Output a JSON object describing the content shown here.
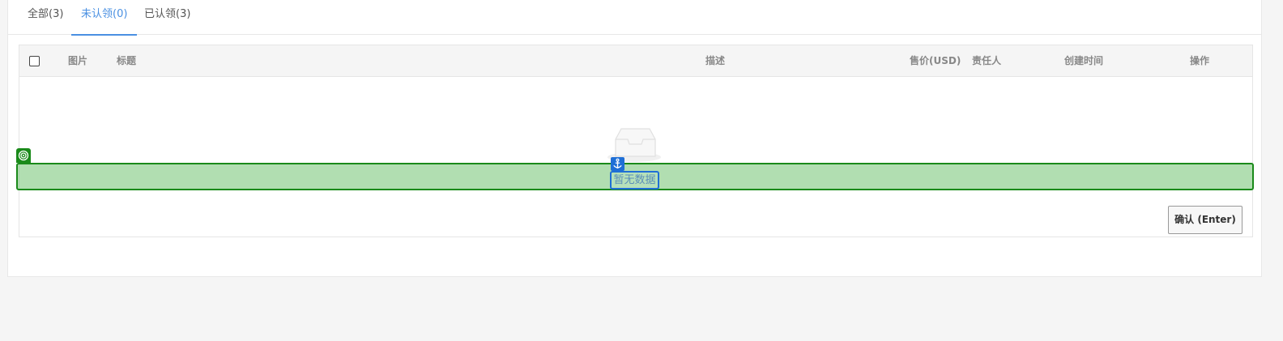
{
  "tabs": [
    {
      "label": "全部(3)",
      "active": false
    },
    {
      "label": "未认领(0)",
      "active": true
    },
    {
      "label": "已认领(3)",
      "active": false
    }
  ],
  "table": {
    "select_all_checked": false,
    "columns": [
      "图片",
      "标题",
      "描述",
      "售价(USD)",
      "责任人",
      "创建时间",
      "操作"
    ],
    "rows": [],
    "empty_text": "暂无数据"
  },
  "confirm_button": {
    "label": "确认 (Enter)"
  },
  "colors": {
    "accent": "#4a90e2",
    "highlight_green": "#1a8a1a",
    "highlight_blue": "#1f6fd6"
  },
  "icons": {
    "empty": "inbox-icon",
    "row_marker": "target-icon",
    "anchor": "anchor-icon"
  }
}
